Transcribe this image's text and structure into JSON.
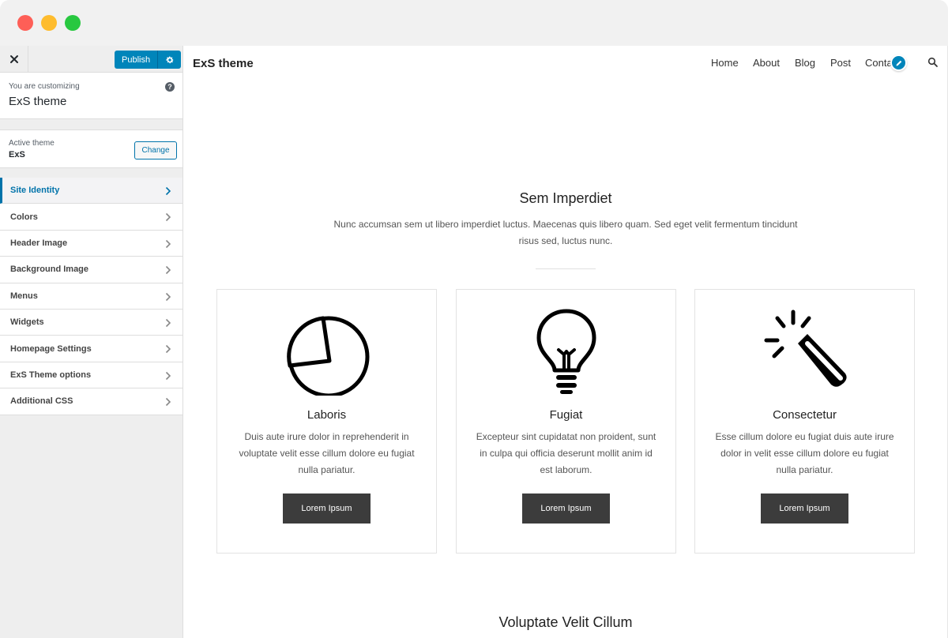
{
  "sidebar": {
    "close_symbol": "✕",
    "publish_label": "Publish",
    "customizing": {
      "label": "You are customizing",
      "value": "ExS theme",
      "help_symbol": "?"
    },
    "active_theme": {
      "label": "Active theme",
      "value": "ExS",
      "change_label": "Change"
    },
    "items": [
      {
        "label": "Site Identity",
        "active": true
      },
      {
        "label": "Colors"
      },
      {
        "label": "Header Image"
      },
      {
        "label": "Background Image"
      },
      {
        "label": "Menus"
      },
      {
        "label": "Widgets"
      },
      {
        "label": "Homepage Settings"
      },
      {
        "label": "ExS Theme options"
      },
      {
        "label": "Additional CSS"
      }
    ]
  },
  "preview": {
    "site_title": "ExS theme",
    "nav": [
      "Home",
      "About",
      "Blog",
      "Post",
      "Conta"
    ],
    "section": {
      "title": "Sem Imperdiet",
      "description": "Nunc accumsan sem ut libero imperdiet luctus. Maecenas quis libero quam. Sed eget velit fermentum tincidunt risus sed, luctus nunc."
    },
    "cards": [
      {
        "icon": "pie-chart-icon",
        "title": "Laboris",
        "text": "Duis aute irure dolor in reprehenderit in voluptate velit esse cillum dolore eu fugiat nulla pariatur.",
        "button": "Lorem Ipsum"
      },
      {
        "icon": "lightbulb-icon",
        "title": "Fugiat",
        "text": "Excepteur sint cupidatat non proident, sunt in culpa qui officia deserunt mollit anim id est laborum.",
        "button": "Lorem Ipsum"
      },
      {
        "icon": "magic-wand-icon",
        "title": "Consectetur",
        "text": "Esse cillum dolore eu fugiat duis aute irure dolor in velit esse cillum dolore eu fugiat nulla pariatur.",
        "button": "Lorem Ipsum"
      }
    ],
    "next_section_title": "Voluptate Velit Cillum"
  },
  "colors": {
    "accent": "#0085ba",
    "button_dark": "#3c3c3c"
  }
}
